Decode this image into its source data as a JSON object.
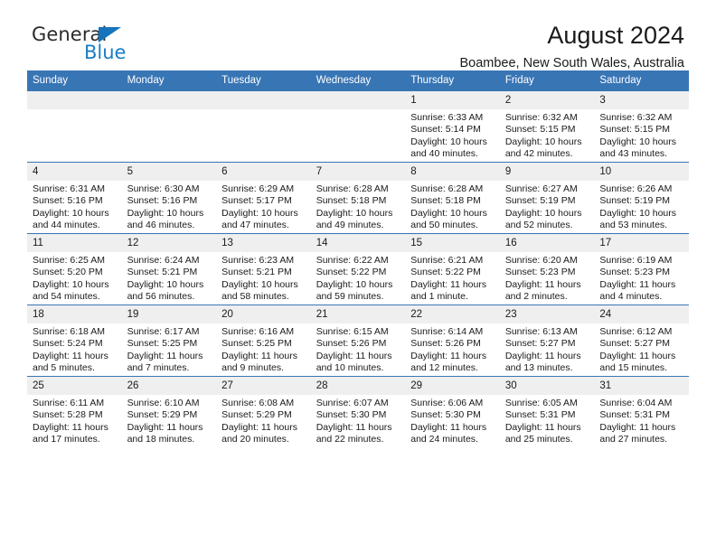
{
  "brand": {
    "name_part1": "General",
    "name_part2": "Blue",
    "triangle_color": "#1574bb",
    "blue_color": "#1a7dc4"
  },
  "header": {
    "title": "August 2024",
    "subtitle": "Boambee, New South Wales, Australia"
  },
  "theme": {
    "header_row_bg": "#3875b5",
    "daynum_bg": "#efefef",
    "grid_line": "#3875b5",
    "text": "#1a1a1a"
  },
  "labels": {
    "sunrise_prefix": "Sunrise:",
    "sunset_prefix": "Sunset:",
    "daylight_prefix": "Daylight:"
  },
  "weekday_headers": [
    "Sunday",
    "Monday",
    "Tuesday",
    "Wednesday",
    "Thursday",
    "Friday",
    "Saturday"
  ],
  "weeks": [
    [
      {
        "day": "",
        "empty": true,
        "sunrise": "",
        "sunset": "",
        "daylight_line1": "",
        "daylight_line2": ""
      },
      {
        "day": "",
        "empty": true,
        "sunrise": "",
        "sunset": "",
        "daylight_line1": "",
        "daylight_line2": ""
      },
      {
        "day": "",
        "empty": true,
        "sunrise": "",
        "sunset": "",
        "daylight_line1": "",
        "daylight_line2": ""
      },
      {
        "day": "",
        "empty": true,
        "sunrise": "",
        "sunset": "",
        "daylight_line1": "",
        "daylight_line2": ""
      },
      {
        "day": "1",
        "empty": false,
        "sunrise": "Sunrise: 6:33 AM",
        "sunset": "Sunset: 5:14 PM",
        "daylight_line1": "Daylight: 10 hours",
        "daylight_line2": "and 40 minutes."
      },
      {
        "day": "2",
        "empty": false,
        "sunrise": "Sunrise: 6:32 AM",
        "sunset": "Sunset: 5:15 PM",
        "daylight_line1": "Daylight: 10 hours",
        "daylight_line2": "and 42 minutes."
      },
      {
        "day": "3",
        "empty": false,
        "sunrise": "Sunrise: 6:32 AM",
        "sunset": "Sunset: 5:15 PM",
        "daylight_line1": "Daylight: 10 hours",
        "daylight_line2": "and 43 minutes."
      }
    ],
    [
      {
        "day": "4",
        "empty": false,
        "sunrise": "Sunrise: 6:31 AM",
        "sunset": "Sunset: 5:16 PM",
        "daylight_line1": "Daylight: 10 hours",
        "daylight_line2": "and 44 minutes."
      },
      {
        "day": "5",
        "empty": false,
        "sunrise": "Sunrise: 6:30 AM",
        "sunset": "Sunset: 5:16 PM",
        "daylight_line1": "Daylight: 10 hours",
        "daylight_line2": "and 46 minutes."
      },
      {
        "day": "6",
        "empty": false,
        "sunrise": "Sunrise: 6:29 AM",
        "sunset": "Sunset: 5:17 PM",
        "daylight_line1": "Daylight: 10 hours",
        "daylight_line2": "and 47 minutes."
      },
      {
        "day": "7",
        "empty": false,
        "sunrise": "Sunrise: 6:28 AM",
        "sunset": "Sunset: 5:18 PM",
        "daylight_line1": "Daylight: 10 hours",
        "daylight_line2": "and 49 minutes."
      },
      {
        "day": "8",
        "empty": false,
        "sunrise": "Sunrise: 6:28 AM",
        "sunset": "Sunset: 5:18 PM",
        "daylight_line1": "Daylight: 10 hours",
        "daylight_line2": "and 50 minutes."
      },
      {
        "day": "9",
        "empty": false,
        "sunrise": "Sunrise: 6:27 AM",
        "sunset": "Sunset: 5:19 PM",
        "daylight_line1": "Daylight: 10 hours",
        "daylight_line2": "and 52 minutes."
      },
      {
        "day": "10",
        "empty": false,
        "sunrise": "Sunrise: 6:26 AM",
        "sunset": "Sunset: 5:19 PM",
        "daylight_line1": "Daylight: 10 hours",
        "daylight_line2": "and 53 minutes."
      }
    ],
    [
      {
        "day": "11",
        "empty": false,
        "sunrise": "Sunrise: 6:25 AM",
        "sunset": "Sunset: 5:20 PM",
        "daylight_line1": "Daylight: 10 hours",
        "daylight_line2": "and 54 minutes."
      },
      {
        "day": "12",
        "empty": false,
        "sunrise": "Sunrise: 6:24 AM",
        "sunset": "Sunset: 5:21 PM",
        "daylight_line1": "Daylight: 10 hours",
        "daylight_line2": "and 56 minutes."
      },
      {
        "day": "13",
        "empty": false,
        "sunrise": "Sunrise: 6:23 AM",
        "sunset": "Sunset: 5:21 PM",
        "daylight_line1": "Daylight: 10 hours",
        "daylight_line2": "and 58 minutes."
      },
      {
        "day": "14",
        "empty": false,
        "sunrise": "Sunrise: 6:22 AM",
        "sunset": "Sunset: 5:22 PM",
        "daylight_line1": "Daylight: 10 hours",
        "daylight_line2": "and 59 minutes."
      },
      {
        "day": "15",
        "empty": false,
        "sunrise": "Sunrise: 6:21 AM",
        "sunset": "Sunset: 5:22 PM",
        "daylight_line1": "Daylight: 11 hours",
        "daylight_line2": "and 1 minute."
      },
      {
        "day": "16",
        "empty": false,
        "sunrise": "Sunrise: 6:20 AM",
        "sunset": "Sunset: 5:23 PM",
        "daylight_line1": "Daylight: 11 hours",
        "daylight_line2": "and 2 minutes."
      },
      {
        "day": "17",
        "empty": false,
        "sunrise": "Sunrise: 6:19 AM",
        "sunset": "Sunset: 5:23 PM",
        "daylight_line1": "Daylight: 11 hours",
        "daylight_line2": "and 4 minutes."
      }
    ],
    [
      {
        "day": "18",
        "empty": false,
        "sunrise": "Sunrise: 6:18 AM",
        "sunset": "Sunset: 5:24 PM",
        "daylight_line1": "Daylight: 11 hours",
        "daylight_line2": "and 5 minutes."
      },
      {
        "day": "19",
        "empty": false,
        "sunrise": "Sunrise: 6:17 AM",
        "sunset": "Sunset: 5:25 PM",
        "daylight_line1": "Daylight: 11 hours",
        "daylight_line2": "and 7 minutes."
      },
      {
        "day": "20",
        "empty": false,
        "sunrise": "Sunrise: 6:16 AM",
        "sunset": "Sunset: 5:25 PM",
        "daylight_line1": "Daylight: 11 hours",
        "daylight_line2": "and 9 minutes."
      },
      {
        "day": "21",
        "empty": false,
        "sunrise": "Sunrise: 6:15 AM",
        "sunset": "Sunset: 5:26 PM",
        "daylight_line1": "Daylight: 11 hours",
        "daylight_line2": "and 10 minutes."
      },
      {
        "day": "22",
        "empty": false,
        "sunrise": "Sunrise: 6:14 AM",
        "sunset": "Sunset: 5:26 PM",
        "daylight_line1": "Daylight: 11 hours",
        "daylight_line2": "and 12 minutes."
      },
      {
        "day": "23",
        "empty": false,
        "sunrise": "Sunrise: 6:13 AM",
        "sunset": "Sunset: 5:27 PM",
        "daylight_line1": "Daylight: 11 hours",
        "daylight_line2": "and 13 minutes."
      },
      {
        "day": "24",
        "empty": false,
        "sunrise": "Sunrise: 6:12 AM",
        "sunset": "Sunset: 5:27 PM",
        "daylight_line1": "Daylight: 11 hours",
        "daylight_line2": "and 15 minutes."
      }
    ],
    [
      {
        "day": "25",
        "empty": false,
        "sunrise": "Sunrise: 6:11 AM",
        "sunset": "Sunset: 5:28 PM",
        "daylight_line1": "Daylight: 11 hours",
        "daylight_line2": "and 17 minutes."
      },
      {
        "day": "26",
        "empty": false,
        "sunrise": "Sunrise: 6:10 AM",
        "sunset": "Sunset: 5:29 PM",
        "daylight_line1": "Daylight: 11 hours",
        "daylight_line2": "and 18 minutes."
      },
      {
        "day": "27",
        "empty": false,
        "sunrise": "Sunrise: 6:08 AM",
        "sunset": "Sunset: 5:29 PM",
        "daylight_line1": "Daylight: 11 hours",
        "daylight_line2": "and 20 minutes."
      },
      {
        "day": "28",
        "empty": false,
        "sunrise": "Sunrise: 6:07 AM",
        "sunset": "Sunset: 5:30 PM",
        "daylight_line1": "Daylight: 11 hours",
        "daylight_line2": "and 22 minutes."
      },
      {
        "day": "29",
        "empty": false,
        "sunrise": "Sunrise: 6:06 AM",
        "sunset": "Sunset: 5:30 PM",
        "daylight_line1": "Daylight: 11 hours",
        "daylight_line2": "and 24 minutes."
      },
      {
        "day": "30",
        "empty": false,
        "sunrise": "Sunrise: 6:05 AM",
        "sunset": "Sunset: 5:31 PM",
        "daylight_line1": "Daylight: 11 hours",
        "daylight_line2": "and 25 minutes."
      },
      {
        "day": "31",
        "empty": false,
        "sunrise": "Sunrise: 6:04 AM",
        "sunset": "Sunset: 5:31 PM",
        "daylight_line1": "Daylight: 11 hours",
        "daylight_line2": "and 27 minutes."
      }
    ]
  ]
}
